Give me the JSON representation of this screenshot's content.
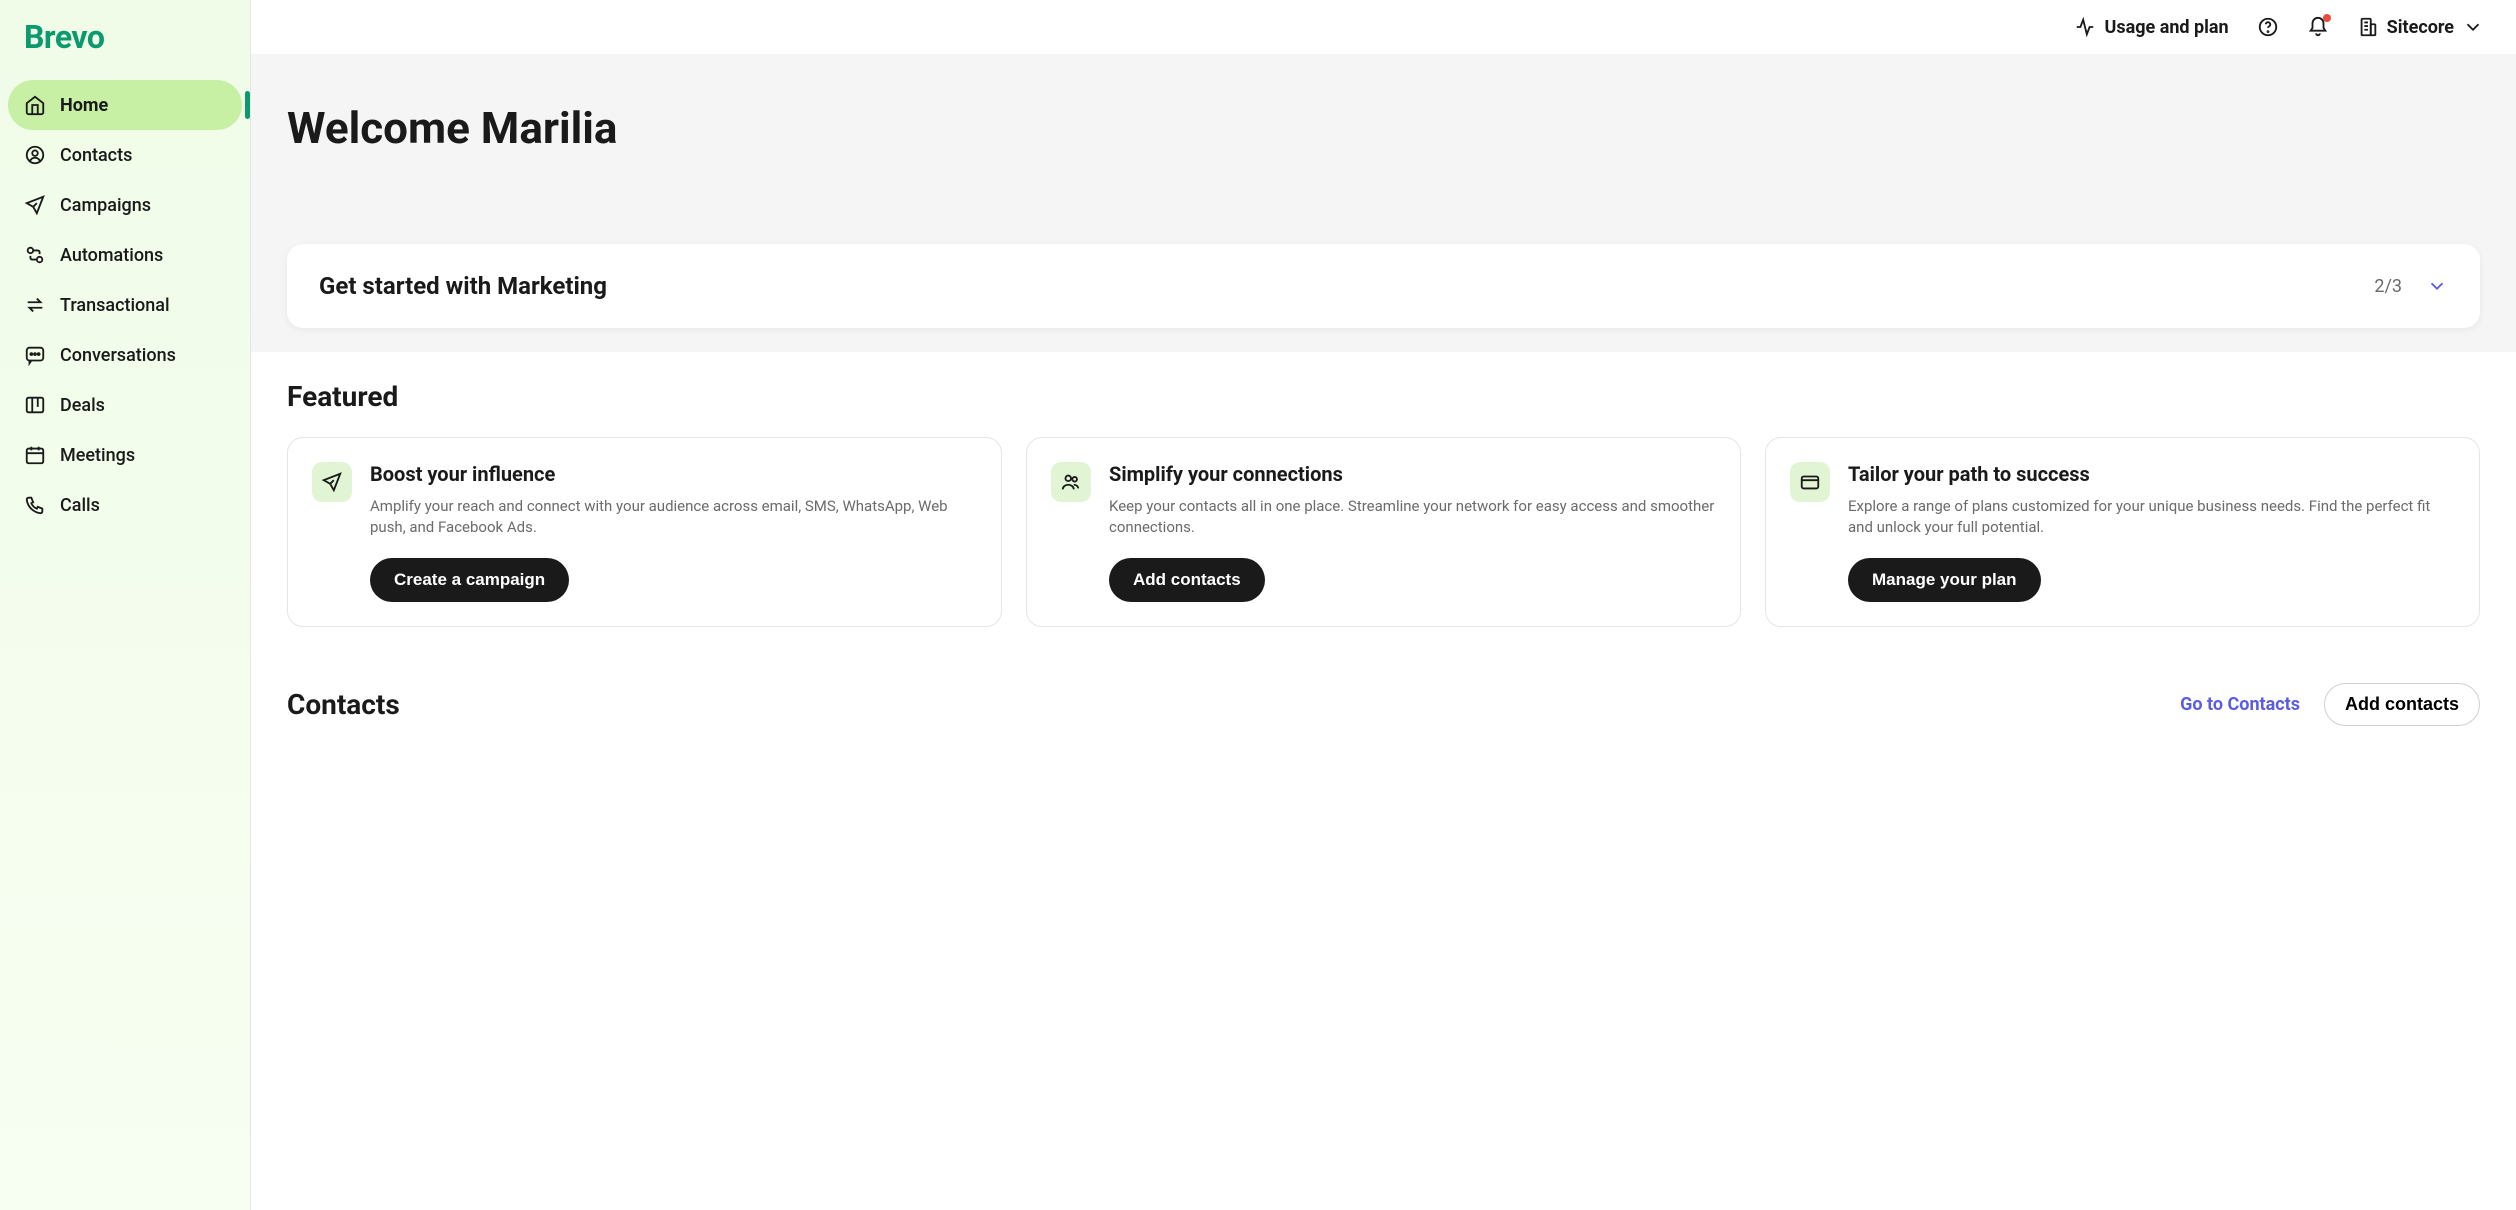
{
  "brand": "Brevo",
  "sidebar": {
    "items": [
      {
        "label": "Home",
        "icon": "home",
        "active": true
      },
      {
        "label": "Contacts",
        "icon": "user",
        "active": false
      },
      {
        "label": "Campaigns",
        "icon": "send",
        "active": false
      },
      {
        "label": "Automations",
        "icon": "automation",
        "active": false
      },
      {
        "label": "Transactional",
        "icon": "swap",
        "active": false
      },
      {
        "label": "Conversations",
        "icon": "chat",
        "active": false
      },
      {
        "label": "Deals",
        "icon": "kanban",
        "active": false
      },
      {
        "label": "Meetings",
        "icon": "calendar",
        "active": false
      },
      {
        "label": "Calls",
        "icon": "phone",
        "active": false
      }
    ]
  },
  "topbar": {
    "usage_label": "Usage and plan",
    "org_name": "Sitecore"
  },
  "welcome": {
    "title": "Welcome Marilia"
  },
  "getstarted": {
    "title": "Get started with Marketing",
    "progress": "2/3"
  },
  "featured": {
    "title": "Featured",
    "cards": [
      {
        "title": "Boost your influence",
        "desc": "Amplify your reach and connect with your audience across email, SMS, WhatsApp, Web push, and Facebook Ads.",
        "cta": "Create a campaign",
        "icon": "send"
      },
      {
        "title": "Simplify your connections",
        "desc": "Keep your contacts all in one place. Streamline your network for easy access and smoother connections.",
        "cta": "Add contacts",
        "icon": "users"
      },
      {
        "title": "Tailor your path to success",
        "desc": "Explore a range of plans customized for your unique business needs. Find the perfect fit and unlock your full potential.",
        "cta": "Manage your plan",
        "icon": "card"
      }
    ]
  },
  "contacts_section": {
    "title": "Contacts",
    "goto_label": "Go to Contacts",
    "add_label": "Add contacts"
  }
}
